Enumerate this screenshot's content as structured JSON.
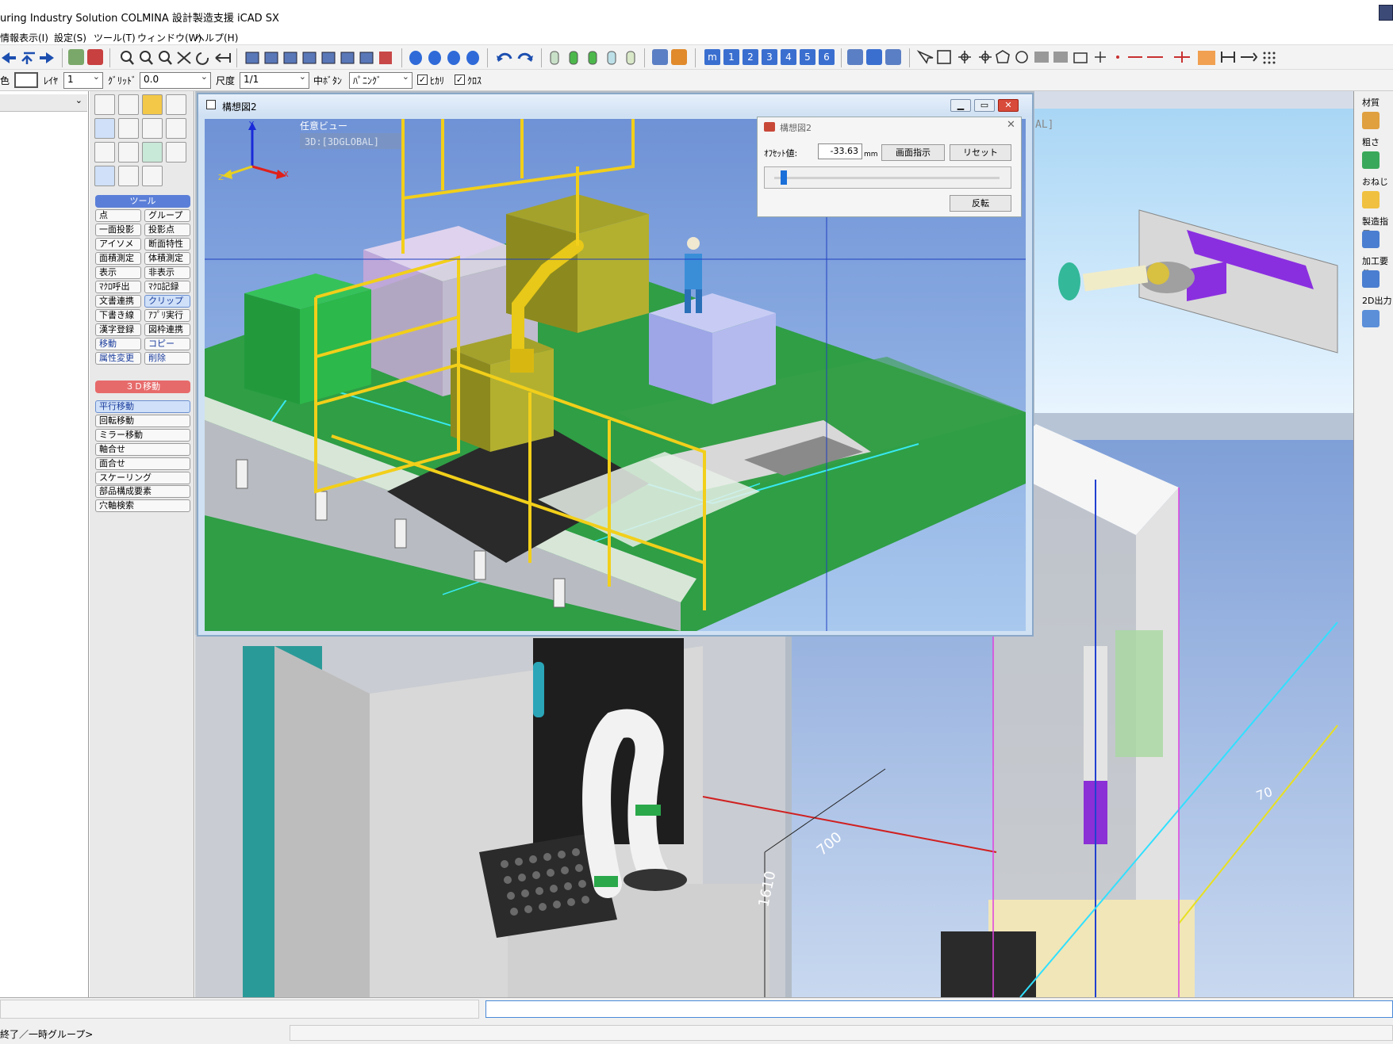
{
  "app": {
    "title": "uring Industry Solution COLMINA 設計製造支援 iCAD SX"
  },
  "menubar": {
    "items": [
      "情報表示(I)",
      "設定(S)",
      "ツール(T)",
      "ウィンドウ(W)",
      "ヘルプ(H)"
    ]
  },
  "toolbar_numbers": [
    "m",
    "1",
    "2",
    "3",
    "4",
    "5",
    "6"
  ],
  "toolbar2": {
    "color_label": "色",
    "layer_label": "ﾚｲﾔ",
    "layer_value": "1",
    "grid_label": "ｸﾞﾘｯﾄﾞ",
    "grid_value": "0.0",
    "scale_label": "尺度",
    "scale_value": "1/1",
    "mid_button_label": "中ﾎﾞﾀﾝ",
    "mid_button_value": "ﾊﾟﾆﾝｸﾞ",
    "hikari_label": "ﾋｶﾘ",
    "kurosu_label": "ｸﾛｽ"
  },
  "tool_palette": {
    "tools_header": "ツール",
    "buttons": [
      [
        "点",
        "グループ"
      ],
      [
        "一面投影",
        "投影点"
      ],
      [
        "アイソメ",
        "断面特性"
      ],
      [
        "面積測定",
        "体積測定"
      ],
      [
        "表示",
        "非表示"
      ],
      [
        "ﾏｸﾛ呼出",
        "ﾏｸﾛ記録"
      ],
      [
        "文書連携",
        "クリップ"
      ],
      [
        "下書き線",
        "ｱﾌﾟﾘ実行"
      ],
      [
        "漢字登録",
        "図枠連携"
      ],
      [
        "移動",
        "コピー"
      ],
      [
        "属性変更",
        "削除"
      ]
    ],
    "move3d_header": "３Ｄ移動",
    "move3d_items": [
      "平行移動",
      "回転移動",
      "ミラー移動",
      "軸合せ",
      "面合せ",
      "スケーリング"
    ],
    "extra_items": [
      "部品構成要素",
      "穴軸検索"
    ]
  },
  "right_toolbar": {
    "labels": [
      "材質",
      "粗さ",
      "おねじ",
      "製造指示",
      "加工要件",
      "2D出力"
    ]
  },
  "window": {
    "title": "構想図2",
    "min_icon": "▁",
    "max_icon": "▭",
    "close_icon": "✕"
  },
  "viewport": {
    "view_name": "任意ビュー",
    "view_code": "3D:[3DGLOBAL]",
    "right_view_code": "AL]",
    "axis_x": "X",
    "axis_y": "Y",
    "axis_z": "Z"
  },
  "clip_dialog": {
    "title": "構想図2",
    "offset_label": "ｵﾌｾｯﾄ値:",
    "offset_value": "-33.63",
    "unit": "mm",
    "screen_button": "画面指示",
    "reset_button": "リセット",
    "flip_button": "反転",
    "close_icon": "✕",
    "slider_fraction": 0.04
  },
  "dimensions": {
    "d1": "1610",
    "d2": "700",
    "d3": "70"
  },
  "status": {
    "text": "終了／一時グループ>"
  }
}
